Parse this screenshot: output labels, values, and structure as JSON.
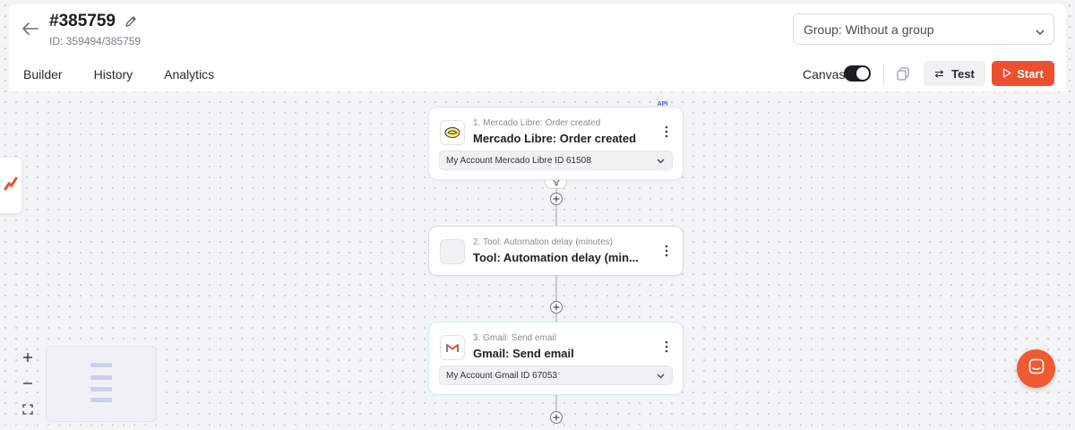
{
  "header": {
    "title": "#385759",
    "subtitle": "ID: 359494/385759",
    "group_select": "Group: Without a group"
  },
  "tabs": [
    {
      "label": "Builder"
    },
    {
      "label": "History"
    },
    {
      "label": "Analytics"
    }
  ],
  "toolbar": {
    "canvas_label": "Canvas",
    "canvas_toggle_on": true,
    "test_label": "Test",
    "start_label": "Start"
  },
  "nodes": [
    {
      "step_label": "1. Mercado Libre: Order created",
      "name": "Mercado Libre: Order created",
      "account": "My Account Mercado Libre ID 61508",
      "badge": "API",
      "icon": "mercado-libre-icon"
    },
    {
      "step_label": "2. Tool: Automation delay (minutes)",
      "name": "Tool: Automation delay (min...",
      "icon": "tool-placeholder-icon"
    },
    {
      "step_label": "3. Gmail: Send email",
      "name": "Gmail: Send email",
      "account": "My Account Gmail ID 67053",
      "icon": "gmail-icon"
    }
  ],
  "colors": {
    "accent": "#ee4f2e",
    "canvas_bg": "#f4f4f6",
    "node3_border": "#cdeeee"
  }
}
